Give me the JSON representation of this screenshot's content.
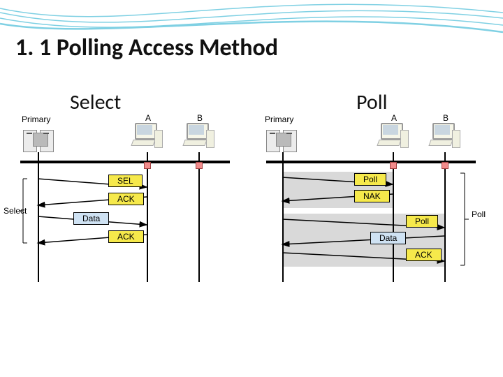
{
  "slide": {
    "title": "1. 1 Polling Access Method",
    "left_heading": "Select",
    "right_heading": "Poll"
  },
  "left_diagram": {
    "primary_label": "Primary",
    "node_a": "A",
    "node_b": "B",
    "side_label": "Select",
    "messages": [
      "SEL",
      "ACK",
      "Data",
      "ACK"
    ],
    "message_styles": [
      "yellow",
      "yellow",
      "blue",
      "yellow"
    ],
    "message_dirs": [
      "right",
      "left",
      "right",
      "left"
    ]
  },
  "right_diagram": {
    "primary_label": "Primary",
    "node_a": "A",
    "node_b": "B",
    "side_label": "Poll",
    "lane1_msgs": [
      "Poll",
      "NAK"
    ],
    "lane1_styles": [
      "yellow",
      "yellow"
    ],
    "lane1_dirs": [
      "right",
      "left"
    ],
    "lane2_msgs": [
      "Poll",
      "Data",
      "ACK"
    ],
    "lane2_styles": [
      "yellow",
      "blue",
      "yellow"
    ],
    "lane2_dirs": [
      "right",
      "left",
      "right"
    ]
  }
}
